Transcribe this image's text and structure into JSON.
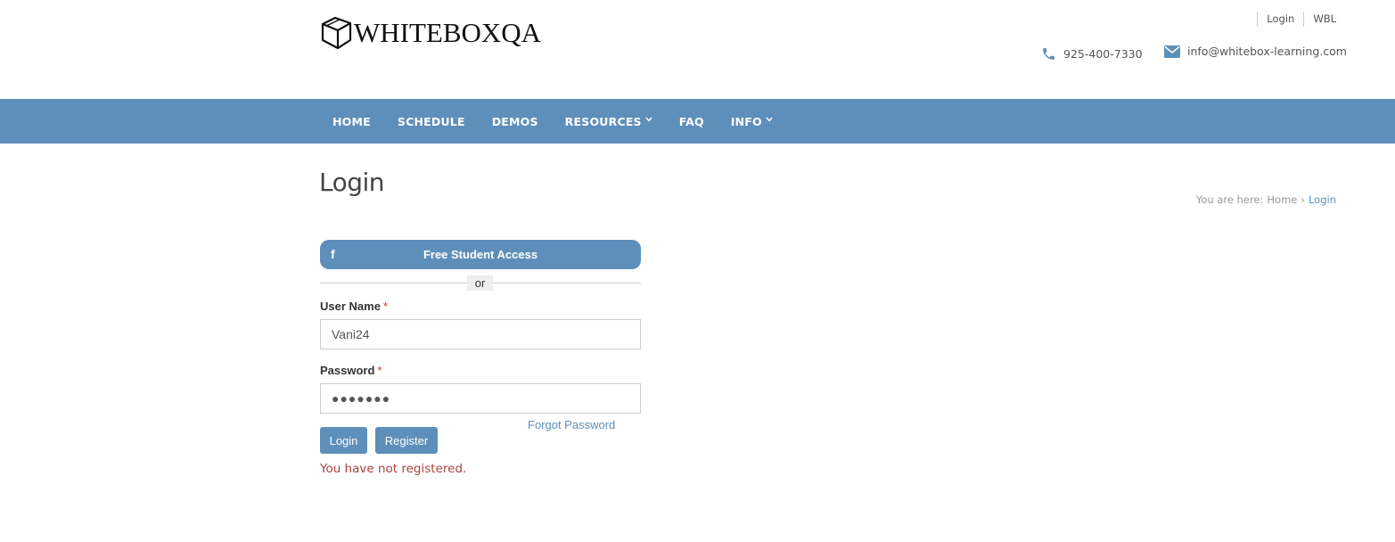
{
  "header": {
    "logo_text": "WHITEBOXQA",
    "top_links": [
      "Login",
      "WBL"
    ],
    "phone": "925-400-7330",
    "email": "info@whitebox-learning.com"
  },
  "nav": {
    "items": [
      {
        "label": "HOME",
        "has_dropdown": false
      },
      {
        "label": "SCHEDULE",
        "has_dropdown": false
      },
      {
        "label": "DEMOS",
        "has_dropdown": false
      },
      {
        "label": "RESOURCES",
        "has_dropdown": true
      },
      {
        "label": "FAQ",
        "has_dropdown": false
      },
      {
        "label": "INFO",
        "has_dropdown": true
      }
    ],
    "chevron": "⌄"
  },
  "page": {
    "title": "Login",
    "breadcrumb": {
      "prefix": "You are here:",
      "home": "Home",
      "separator": "›",
      "current": "Login"
    }
  },
  "form": {
    "fb_button_label": "Free Student Access",
    "fb_icon": "f",
    "or_label": "or",
    "username_label": "User Name",
    "password_label": "Password",
    "required_marker": "*",
    "username_value": "Vani24",
    "password_value": "●●●●●●●",
    "forgot_password": "Forgot Password",
    "login_button": "Login",
    "register_button": "Register",
    "error_message": "You have not registered."
  },
  "colors": {
    "brand": "#5e8fba",
    "error": "#a94442",
    "required": "#cc3333"
  }
}
